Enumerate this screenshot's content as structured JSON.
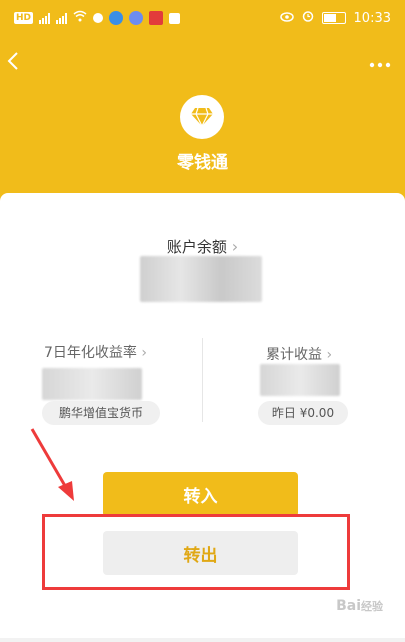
{
  "status_bar": {
    "left_tags": [
      "HD",
      "4G",
      "4G"
    ],
    "time": "10:33"
  },
  "header": {
    "title": "零钱通",
    "back_icon": "chevron-left-icon",
    "more_icon": "more-dots-icon",
    "logo_icon": "diamond-icon",
    "bg_color": "#F1BC1A"
  },
  "balance": {
    "label": "账户余额",
    "chevron": "›"
  },
  "stats": {
    "left": {
      "label": "7日年化收益率",
      "chevron": "›",
      "chip": "鹏华增值宝货币"
    },
    "right": {
      "label": "累计收益",
      "chevron": "›",
      "chip": "昨日 ¥0.00"
    }
  },
  "actions": {
    "transfer_in": "转入",
    "transfer_out": "转出"
  },
  "annotation": {
    "highlight_color": "#EE3B3B"
  },
  "watermark": {
    "text": "Bai",
    "suffix": "经验"
  }
}
